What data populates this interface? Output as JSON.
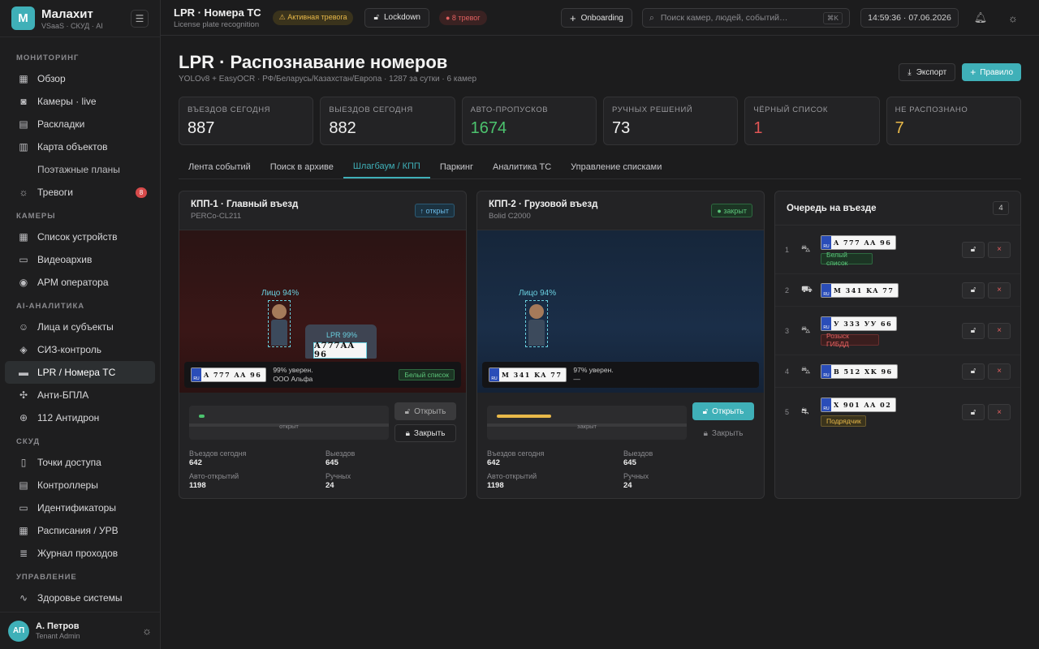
{
  "brand": {
    "logo": "М",
    "name": "Малахит",
    "sub": "VSaaS · СКУД · AI"
  },
  "nav": {
    "sec_monitoring": "МОНИТОРИНГ",
    "overview": "Обзор",
    "cameras_live": "Камеры · live",
    "layouts": "Раскладки",
    "object_map": "Карта объектов",
    "floor_plans": "Поэтажные планы",
    "alarms": "Тревоги",
    "alarms_count": "8",
    "sec_cameras": "КАМЕРЫ",
    "device_list": "Список устройств",
    "video_archive": "Видеоархив",
    "operator_ws": "АРМ оператора",
    "sec_ai": "AI-АНАЛИТИКА",
    "faces": "Лица и субъекты",
    "ppe": "СИЗ-контроль",
    "lpr": "LPR / Номера ТС",
    "anti_uav": "Анти-БПЛА",
    "antidrone": "112 Антидрон",
    "sec_acs": "СКУД",
    "access_points": "Точки доступа",
    "controllers": "Контроллеры",
    "identifiers": "Идентификаторы",
    "schedules": "Расписания / УРВ",
    "pass_log": "Журнал проходов",
    "sec_manage": "УПРАВЛЕНИЕ",
    "system_health": "Здоровье системы"
  },
  "user": {
    "initials": "АП",
    "name": "А. Петров",
    "role": "Tenant Admin"
  },
  "topbar": {
    "title": "LPR · Номера ТС",
    "subtitle": "License plate recognition",
    "alert": "⚠ Активная тревога",
    "lockdown": "Lockdown",
    "alarms": "● 8 тревог",
    "onboarding": "Onboarding",
    "search_placeholder": "Поиск камер, людей, событий…",
    "search_kbd": "⌘K",
    "clock": "14:59:36 · 07.06.2026"
  },
  "page": {
    "title": "LPR · Распознавание номеров",
    "subtitle": "YOLOv8 + EasyOCR · РФ/Беларусь/Казахстан/Европа · 1287 за сутки · 6 камер",
    "export": "Экспорт",
    "rule": "Правило"
  },
  "kpis": [
    {
      "label": "ВЪЕЗДОВ СЕГОДНЯ",
      "value": "887",
      "color": "#f2f2f2"
    },
    {
      "label": "ВЫЕЗДОВ СЕГОДНЯ",
      "value": "882",
      "color": "#f2f2f2"
    },
    {
      "label": "АВТО-ПРОПУСКОВ",
      "value": "1674",
      "color": "#4cc36e"
    },
    {
      "label": "РУЧНЫХ РЕШЕНИЙ",
      "value": "73",
      "color": "#f2f2f2"
    },
    {
      "label": "ЧЁРНЫЙ СПИСОК",
      "value": "1",
      "color": "#e05555"
    },
    {
      "label": "НЕ РАСПОЗНАНО",
      "value": "7",
      "color": "#e9b949"
    }
  ],
  "tabs": [
    "Лента событий",
    "Поиск в архиве",
    "Шлагбаум / КПП",
    "Паркинг",
    "Аналитика ТС",
    "Управление списками"
  ],
  "checkpoints": [
    {
      "title": "КПП-1 · Главный въезд",
      "device": "PERCo-CL211",
      "status": "↑ открыт",
      "face": "Лицо 94%",
      "lpr": "LPR 99%",
      "lpr_plate": "A777AA 96",
      "flag": "RU",
      "plate": "A 777 AA 96",
      "conf": "99% уверен.",
      "owner": "ООО Альфа",
      "list_tag": "Белый список",
      "gate_label": "открыт",
      "gate_fill": 0.03,
      "open_btn": "Открыть",
      "close_btn": "Закрыть",
      "stats": {
        "l1": "Въездов сегодня",
        "v1": "642",
        "l2": "Выездов",
        "v2": "645",
        "l3": "Авто-открытий",
        "v3": "1198",
        "l4": "Ручных",
        "v4": "24"
      }
    },
    {
      "title": "КПП-2 · Грузовой въезд",
      "device": "Bolid C2000",
      "status": "● закрыт",
      "face": "Лицо 94%",
      "flag": "RU",
      "plate": "M 341 KA 77",
      "conf": "97% уверен.",
      "owner": "—",
      "gate_label": "закрыт",
      "gate_fill": 0.3,
      "open_btn": "Открыть",
      "close_btn": "Закрыть",
      "stats": {
        "l1": "Въездов сегодня",
        "v1": "642",
        "l2": "Выездов",
        "v2": "645",
        "l3": "Авто-открытий",
        "v3": "1198",
        "l4": "Ручных",
        "v4": "24"
      }
    }
  ],
  "queue": {
    "title": "Очередь на въезде",
    "count": "4",
    "items": [
      {
        "idx": "1",
        "plate": "A 777 AA 96",
        "flag": "RU",
        "tag": "Белый список",
        "tag_type": "green",
        "icon": "car-icon"
      },
      {
        "idx": "2",
        "plate": "M 341 KA 77",
        "flag": "RU",
        "tag": "",
        "tag_type": "",
        "icon": "truck-icon"
      },
      {
        "idx": "3",
        "plate": "У 333 УУ 66",
        "flag": "RU",
        "tag": "Розыск ГИБДД",
        "tag_type": "red",
        "icon": "car-icon"
      },
      {
        "idx": "4",
        "plate": "B 512 XK 96",
        "flag": "RU",
        "tag": "",
        "tag_type": "",
        "icon": "car-icon"
      },
      {
        "idx": "5",
        "plate": "X 901 AA 02",
        "flag": "RU",
        "tag": "Подрядчик",
        "tag_type": "yellow",
        "icon": "van-icon"
      }
    ]
  }
}
